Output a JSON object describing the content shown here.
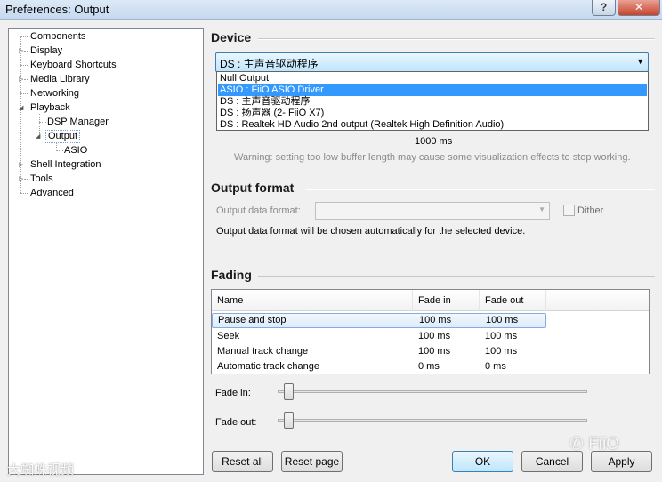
{
  "window": {
    "title": "Preferences: Output",
    "help_glyph": "?",
    "close_glyph": "✕"
  },
  "tree": {
    "items": [
      {
        "label": "Components"
      },
      {
        "label": "Display"
      },
      {
        "label": "Keyboard Shortcuts"
      },
      {
        "label": "Media Library"
      },
      {
        "label": "Networking"
      },
      {
        "label": "Playback"
      },
      {
        "label": "DSP Manager"
      },
      {
        "label": "Output"
      },
      {
        "label": "ASIO"
      },
      {
        "label": "Shell Integration"
      },
      {
        "label": "Tools"
      },
      {
        "label": "Advanced"
      }
    ]
  },
  "device": {
    "section_title": "Device",
    "selected": "DS : 主声音驱动程序",
    "options": [
      "Null Output",
      "ASIO : FiiO ASIO Driver",
      "DS : 主声音驱动程序",
      "DS : 扬声器 (2- FiiO X7)",
      "DS : Realtek HD Audio 2nd output (Realtek High Definition Audio)"
    ],
    "highlighted_option": "ASIO : FiiO ASIO Driver",
    "buffer_value": "1000 ms",
    "warning": "Warning: setting too low buffer length may cause some visualization effects to stop working."
  },
  "output_format": {
    "section_title": "Output format",
    "data_format_label": "Output data format:",
    "data_format_value": "",
    "dither_label": "Dither",
    "dither_checked": false,
    "note": "Output data format will be chosen automatically for the selected device."
  },
  "fading": {
    "section_title": "Fading",
    "columns": [
      "Name",
      "Fade in",
      "Fade out"
    ],
    "rows": [
      {
        "name": "Pause and stop",
        "fade_in": "100 ms",
        "fade_out": "100 ms"
      },
      {
        "name": "Seek",
        "fade_in": "100 ms",
        "fade_out": "100 ms"
      },
      {
        "name": "Manual track change",
        "fade_in": "100 ms",
        "fade_out": "100 ms"
      },
      {
        "name": "Automatic track change",
        "fade_in": "0 ms",
        "fade_out": "0 ms"
      }
    ],
    "fade_in_label": "Fade in:",
    "fade_out_label": "Fade out:",
    "fade_in_slider_fraction": 0.02,
    "fade_out_slider_fraction": 0.02
  },
  "buttons": {
    "reset_all": "Reset all",
    "reset_page": "Reset page",
    "ok": "OK",
    "cancel": "Cancel",
    "apply": "Apply"
  },
  "watermarks": {
    "right": "FiiO",
    "left": "大蜘蛛视频"
  }
}
